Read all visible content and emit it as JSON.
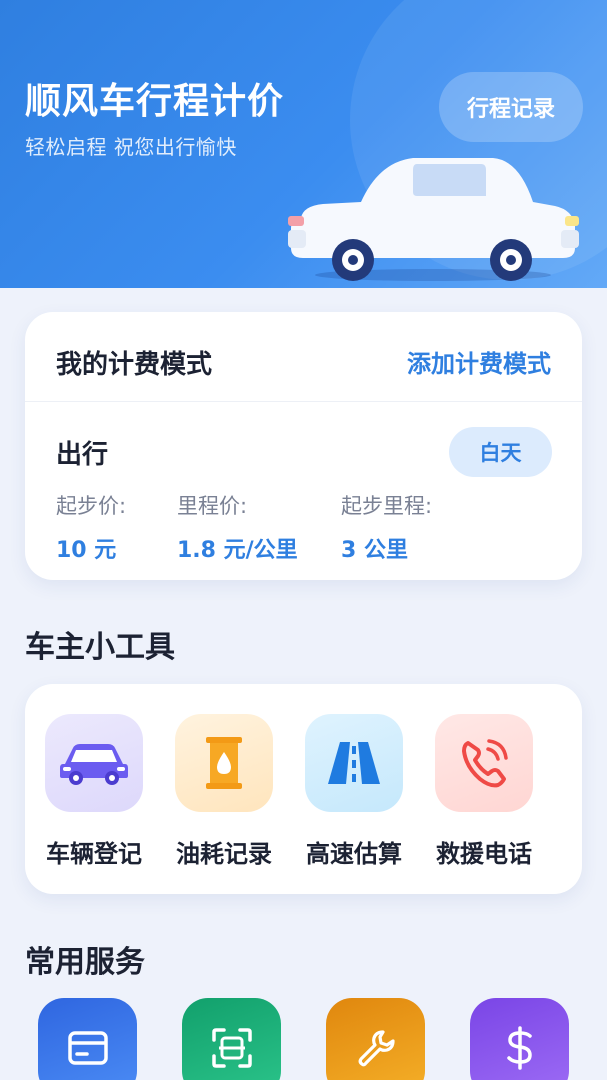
{
  "header": {
    "title": "顺风车行程计价",
    "subtitle": "轻松启程 祝您出行愉快",
    "trip_record_label": "行程记录"
  },
  "billing": {
    "title": "我的计费模式",
    "add_label": "添加计费模式",
    "mode": {
      "name": "出行",
      "badge": "白天",
      "items": [
        {
          "label": "起步价:",
          "value": "10 元"
        },
        {
          "label": "里程价:",
          "value": "1.8 元/公里"
        },
        {
          "label": "起步里程:",
          "value": "3 公里"
        }
      ]
    }
  },
  "tools": {
    "title": "车主小工具",
    "items": [
      {
        "label": "车辆登记",
        "icon": "car-icon"
      },
      {
        "label": "油耗记录",
        "icon": "fuel-barrel-icon"
      },
      {
        "label": "高速估算",
        "icon": "highway-icon"
      },
      {
        "label": "救援电话",
        "icon": "phone-icon"
      }
    ]
  },
  "services": {
    "title": "常用服务",
    "items": [
      {
        "icon": "card-icon"
      },
      {
        "icon": "scan-icon"
      },
      {
        "icon": "wrench-icon"
      },
      {
        "icon": "dollar-icon"
      }
    ]
  },
  "colors": {
    "accent": "#2f7fe0",
    "hero_start": "#2f7fe0",
    "hero_end": "#63a9f7",
    "background": "#eef2fb"
  }
}
